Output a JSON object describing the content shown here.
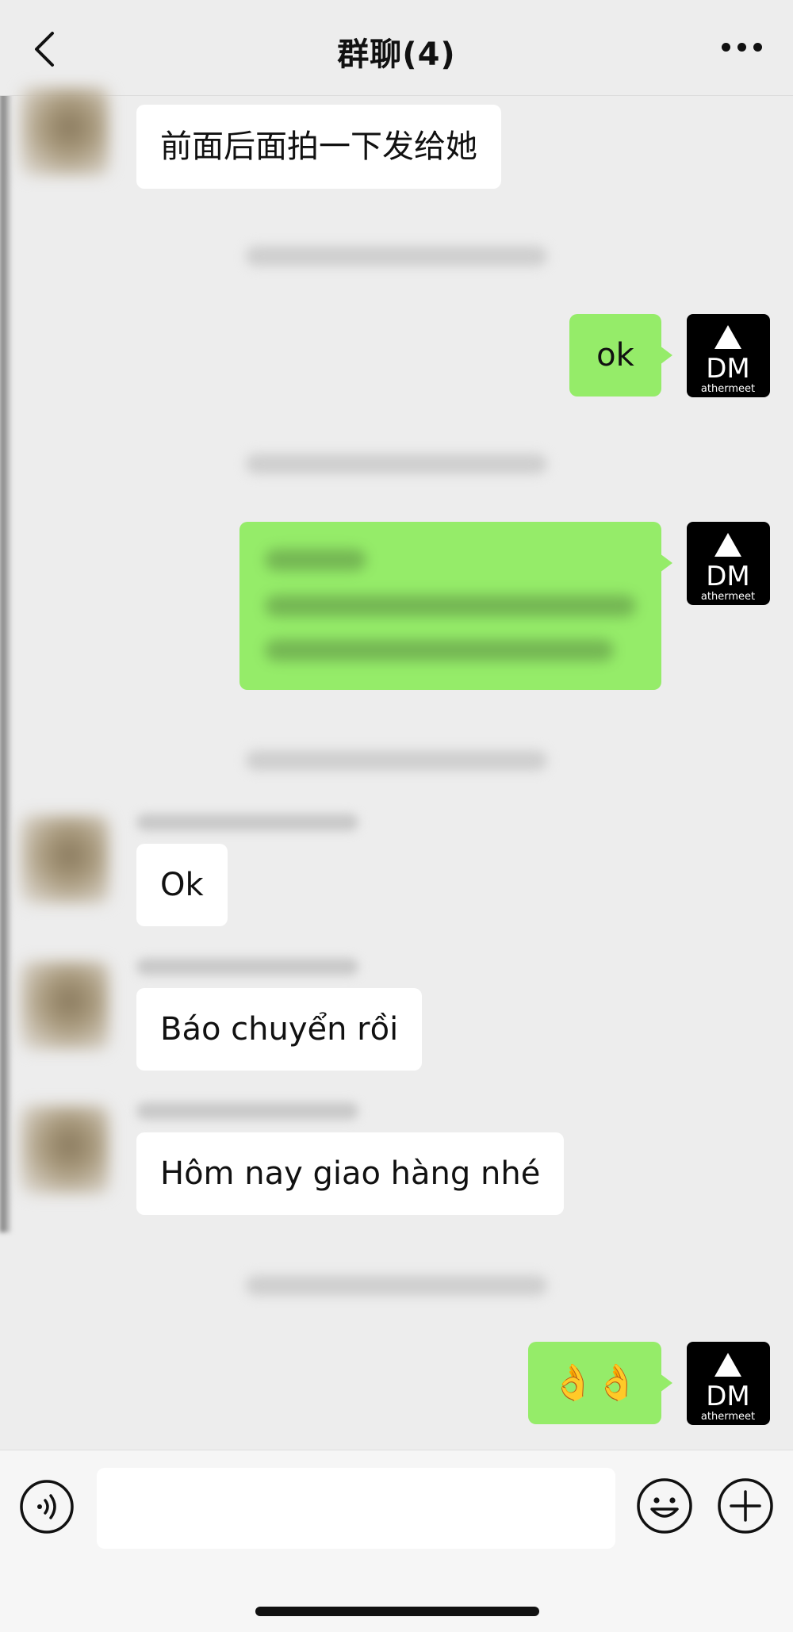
{
  "header": {
    "title": "群聊(4)",
    "back_icon": "chevron-left-icon",
    "more_icon": "ellipsis-icon"
  },
  "messages": [
    {
      "sender": "other",
      "text": "前面后面拍一下发给她"
    },
    {
      "sender": "me",
      "text": "ok"
    },
    {
      "sender": "me",
      "text": "",
      "blurred": true
    },
    {
      "sender": "other",
      "text": "Ok"
    },
    {
      "sender": "other",
      "text": "Báo chuyển rồi"
    },
    {
      "sender": "other",
      "text": "Hôm nay giao hàng nhé"
    },
    {
      "sender": "me",
      "text": "👌👌"
    }
  ],
  "my_avatar": {
    "logo_letters": "DM",
    "logo_text": "athermeet"
  },
  "input_bar": {
    "placeholder": "",
    "voice_icon": "voice-icon",
    "emoji_icon": "emoji-icon",
    "plus_icon": "plus-icon"
  },
  "colors": {
    "background": "#ededed",
    "my_bubble": "#95ec69",
    "other_bubble": "#ffffff"
  }
}
